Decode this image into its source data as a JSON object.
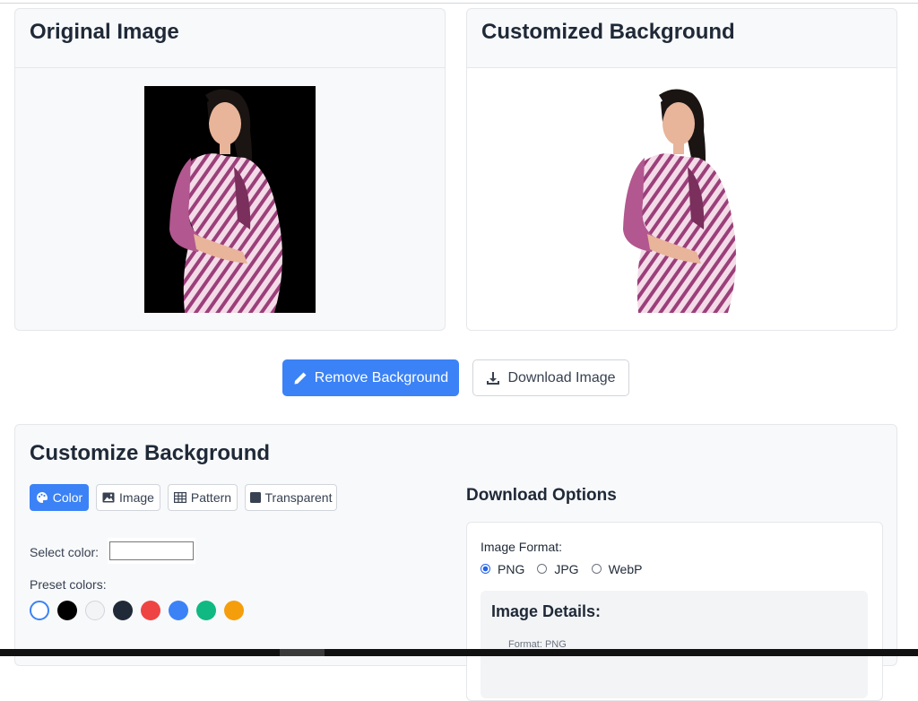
{
  "original": {
    "title": "Original Image"
  },
  "customized": {
    "title": "Customized Background"
  },
  "actions": {
    "remove_label": "Remove Background",
    "download_label": "Download Image"
  },
  "customize": {
    "title": "Customize Background",
    "tabs": [
      {
        "label": "Color",
        "icon": "palette-icon",
        "active": true
      },
      {
        "label": "Image",
        "icon": "image-icon",
        "active": false
      },
      {
        "label": "Pattern",
        "icon": "grid-icon",
        "active": false
      },
      {
        "label": "Transparent",
        "icon": "square-icon",
        "active": false
      }
    ],
    "select_color_label": "Select color:",
    "preset_label": "Preset colors:",
    "preset_colors": [
      "#ffffff",
      "#000000",
      "#f3f4f6",
      "#1f2937",
      "#ef4444",
      "#3b82f6",
      "#10b981",
      "#f59e0b"
    ],
    "selected_color": "#ffffff"
  },
  "download_options": {
    "title": "Download Options",
    "format_label": "Image Format:",
    "formats": [
      {
        "label": "PNG",
        "checked": true
      },
      {
        "label": "JPG",
        "checked": false
      },
      {
        "label": "WebP",
        "checked": false
      }
    ],
    "details_title": "Image Details:",
    "details_format": "Format: PNG"
  },
  "colors": {
    "accent": "#3b82f6",
    "card_bg": "#f8f9fb",
    "border": "#e5e7eb"
  }
}
